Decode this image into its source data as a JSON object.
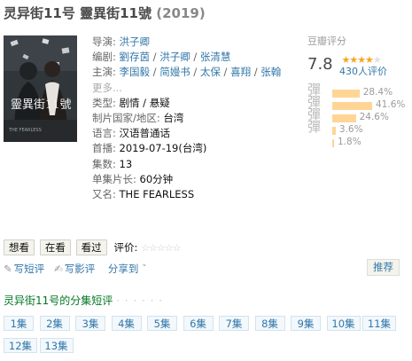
{
  "header": {
    "title": "灵异街11号 靈異街11號",
    "year": "(2019)"
  },
  "poster": {
    "caption": "靈異街11號",
    "alt_title": "THE FEARLESS"
  },
  "info": {
    "director_label": "导演:",
    "directors": [
      "洪子卿"
    ],
    "writer_label": "编剧:",
    "writers": [
      "劉存茵",
      "洪子卿",
      "张清慧"
    ],
    "cast_label": "主演:",
    "cast": [
      "李国毅",
      "简嫚书",
      "太保",
      "喜翔",
      "张翰"
    ],
    "cast_more": "更多...",
    "genre_label": "类型:",
    "genre": "剧情 / 悬疑",
    "country_label": "制片国家/地区:",
    "country": "台湾",
    "language_label": "语言:",
    "language": "汉语普通话",
    "premiere_label": "首播:",
    "premiere": "2019-07-19(台湾)",
    "episodes_label": "集数:",
    "episodes": "13",
    "runtime_label": "单集片长:",
    "runtime": "60分钟",
    "aka_label": "又名:",
    "aka": "THE FEARLESS"
  },
  "rating": {
    "label": "豆瓣评分",
    "score": "7.8",
    "stars_value": 4,
    "stars_max": 5,
    "people": "430人评价",
    "distribution": [
      {
        "pct": "28.4%",
        "value": 28.4
      },
      {
        "pct": "41.6%",
        "value": 41.6
      },
      {
        "pct": "24.6%",
        "value": 24.6
      },
      {
        "pct": "3.6%",
        "value": 3.6
      },
      {
        "pct": "1.8%",
        "value": 1.8
      }
    ],
    "ghost_text": "彈彈彈彈"
  },
  "actions": {
    "want": "想看",
    "watching": "在看",
    "watched": "看过",
    "rate_label": "评价:",
    "rate_stars": "☆☆☆☆☆"
  },
  "sublinks": {
    "short_review": "写短评",
    "review": "写影评",
    "share": "分享到"
  },
  "recommend": "推荐",
  "episode_section": {
    "title": "灵异街11号的分集短评",
    "dots": "· · · · · ·"
  },
  "episode_buttons": [
    "1集",
    "2集",
    "3集",
    "4集",
    "5集",
    "6集",
    "7集",
    "8集",
    "9集",
    "10集",
    "11集",
    "12集",
    "13集"
  ],
  "colors": {
    "link": "#3377aa",
    "green": "#007722",
    "star": "#f5a623",
    "bar": "#ffd596"
  }
}
